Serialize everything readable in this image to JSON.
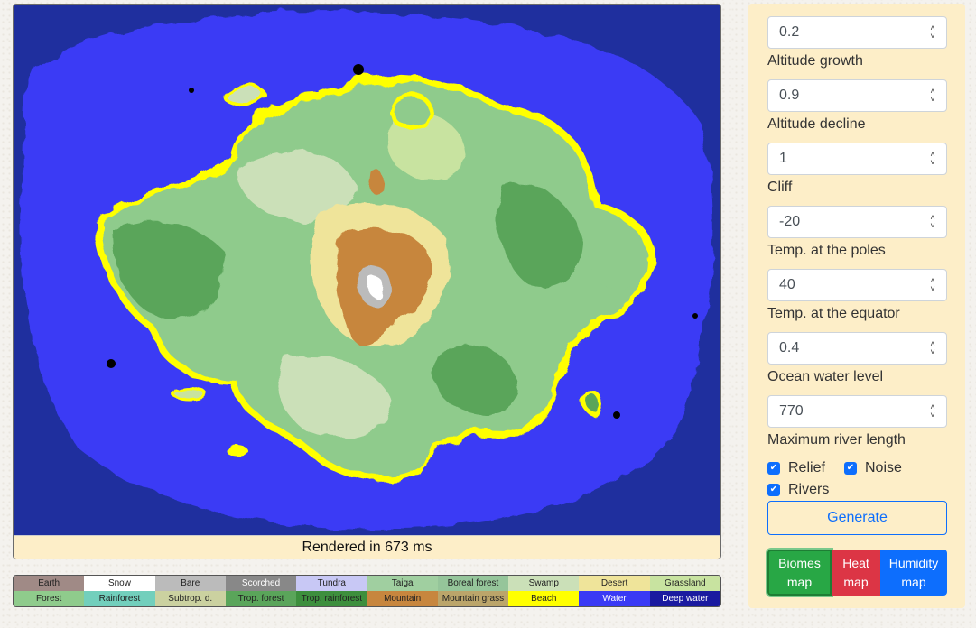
{
  "render_status": "Rendered in 673 ms",
  "fields": [
    {
      "value": "0.2",
      "label": "Altitude growth"
    },
    {
      "value": "0.9",
      "label": "Altitude decline"
    },
    {
      "value": "1",
      "label": "Cliff"
    },
    {
      "value": "-20",
      "label": "Temp. at the poles"
    },
    {
      "value": "40",
      "label": "Temp. at the equator"
    },
    {
      "value": "0.4",
      "label": "Ocean water level"
    },
    {
      "value": "770",
      "label": "Maximum river length"
    }
  ],
  "checkboxes": {
    "relief": {
      "label": "Relief",
      "checked": true
    },
    "noise": {
      "label": "Noise",
      "checked": true
    },
    "rivers": {
      "label": "Rivers",
      "checked": true
    }
  },
  "generate_label": "Generate",
  "map_buttons": {
    "biomes": [
      "Biomes",
      "map"
    ],
    "heat": [
      "Heat",
      "map"
    ],
    "humidity": [
      "Humidity",
      "map"
    ]
  },
  "legend_row1": [
    {
      "label": "Earth",
      "color": "#a08a86"
    },
    {
      "label": "Snow",
      "color": "#ffffff"
    },
    {
      "label": "Bare",
      "color": "#bbbbbb"
    },
    {
      "label": "Scorched",
      "color": "#888888"
    },
    {
      "label": "Tundra",
      "color": "#c8c8f5"
    },
    {
      "label": "Taiga",
      "color": "#a0cfa0"
    },
    {
      "label": "Boreal forest",
      "color": "#95c59a"
    },
    {
      "label": "Swamp",
      "color": "#cbe0b8"
    },
    {
      "label": "Desert",
      "color": "#efe49a"
    },
    {
      "label": "Grassland",
      "color": "#c8e3a0"
    }
  ],
  "legend_row2": [
    {
      "label": "Forest",
      "color": "#8fcb8c"
    },
    {
      "label": "Rainforest",
      "color": "#72cfbc"
    },
    {
      "label": "Subtrop. d.",
      "color": "#cbd1a0"
    },
    {
      "label": "Trop. forest",
      "color": "#5aa55a"
    },
    {
      "label": "Trop. rainforest",
      "color": "#3d8f3d"
    },
    {
      "label": "Mountain",
      "color": "#c7863e"
    },
    {
      "label": "Mountain grass",
      "color": "#bba56a"
    },
    {
      "label": "Beach",
      "color": "#ffff00"
    },
    {
      "label": "Water",
      "color": "#3a3af5"
    },
    {
      "label": "Deep water",
      "color": "#1a1aa0"
    }
  ]
}
